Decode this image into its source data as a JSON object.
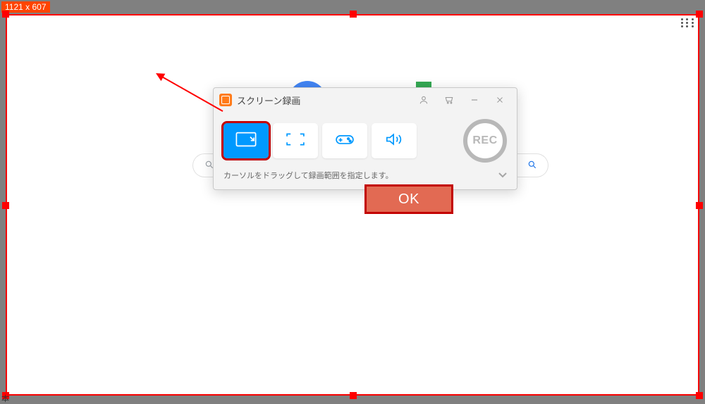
{
  "selection": {
    "dimensions_text": "1121 x 607"
  },
  "dialog": {
    "title": "スクリーン録画",
    "rec_label": "REC",
    "hint_text": "カーソルをドラッグして録画範囲を指定します。",
    "modes": {
      "region": "region",
      "fullscreen": "fullscreen",
      "game": "game",
      "audio": "audio"
    }
  },
  "ok": {
    "label": "OK"
  },
  "corner_text": "本"
}
